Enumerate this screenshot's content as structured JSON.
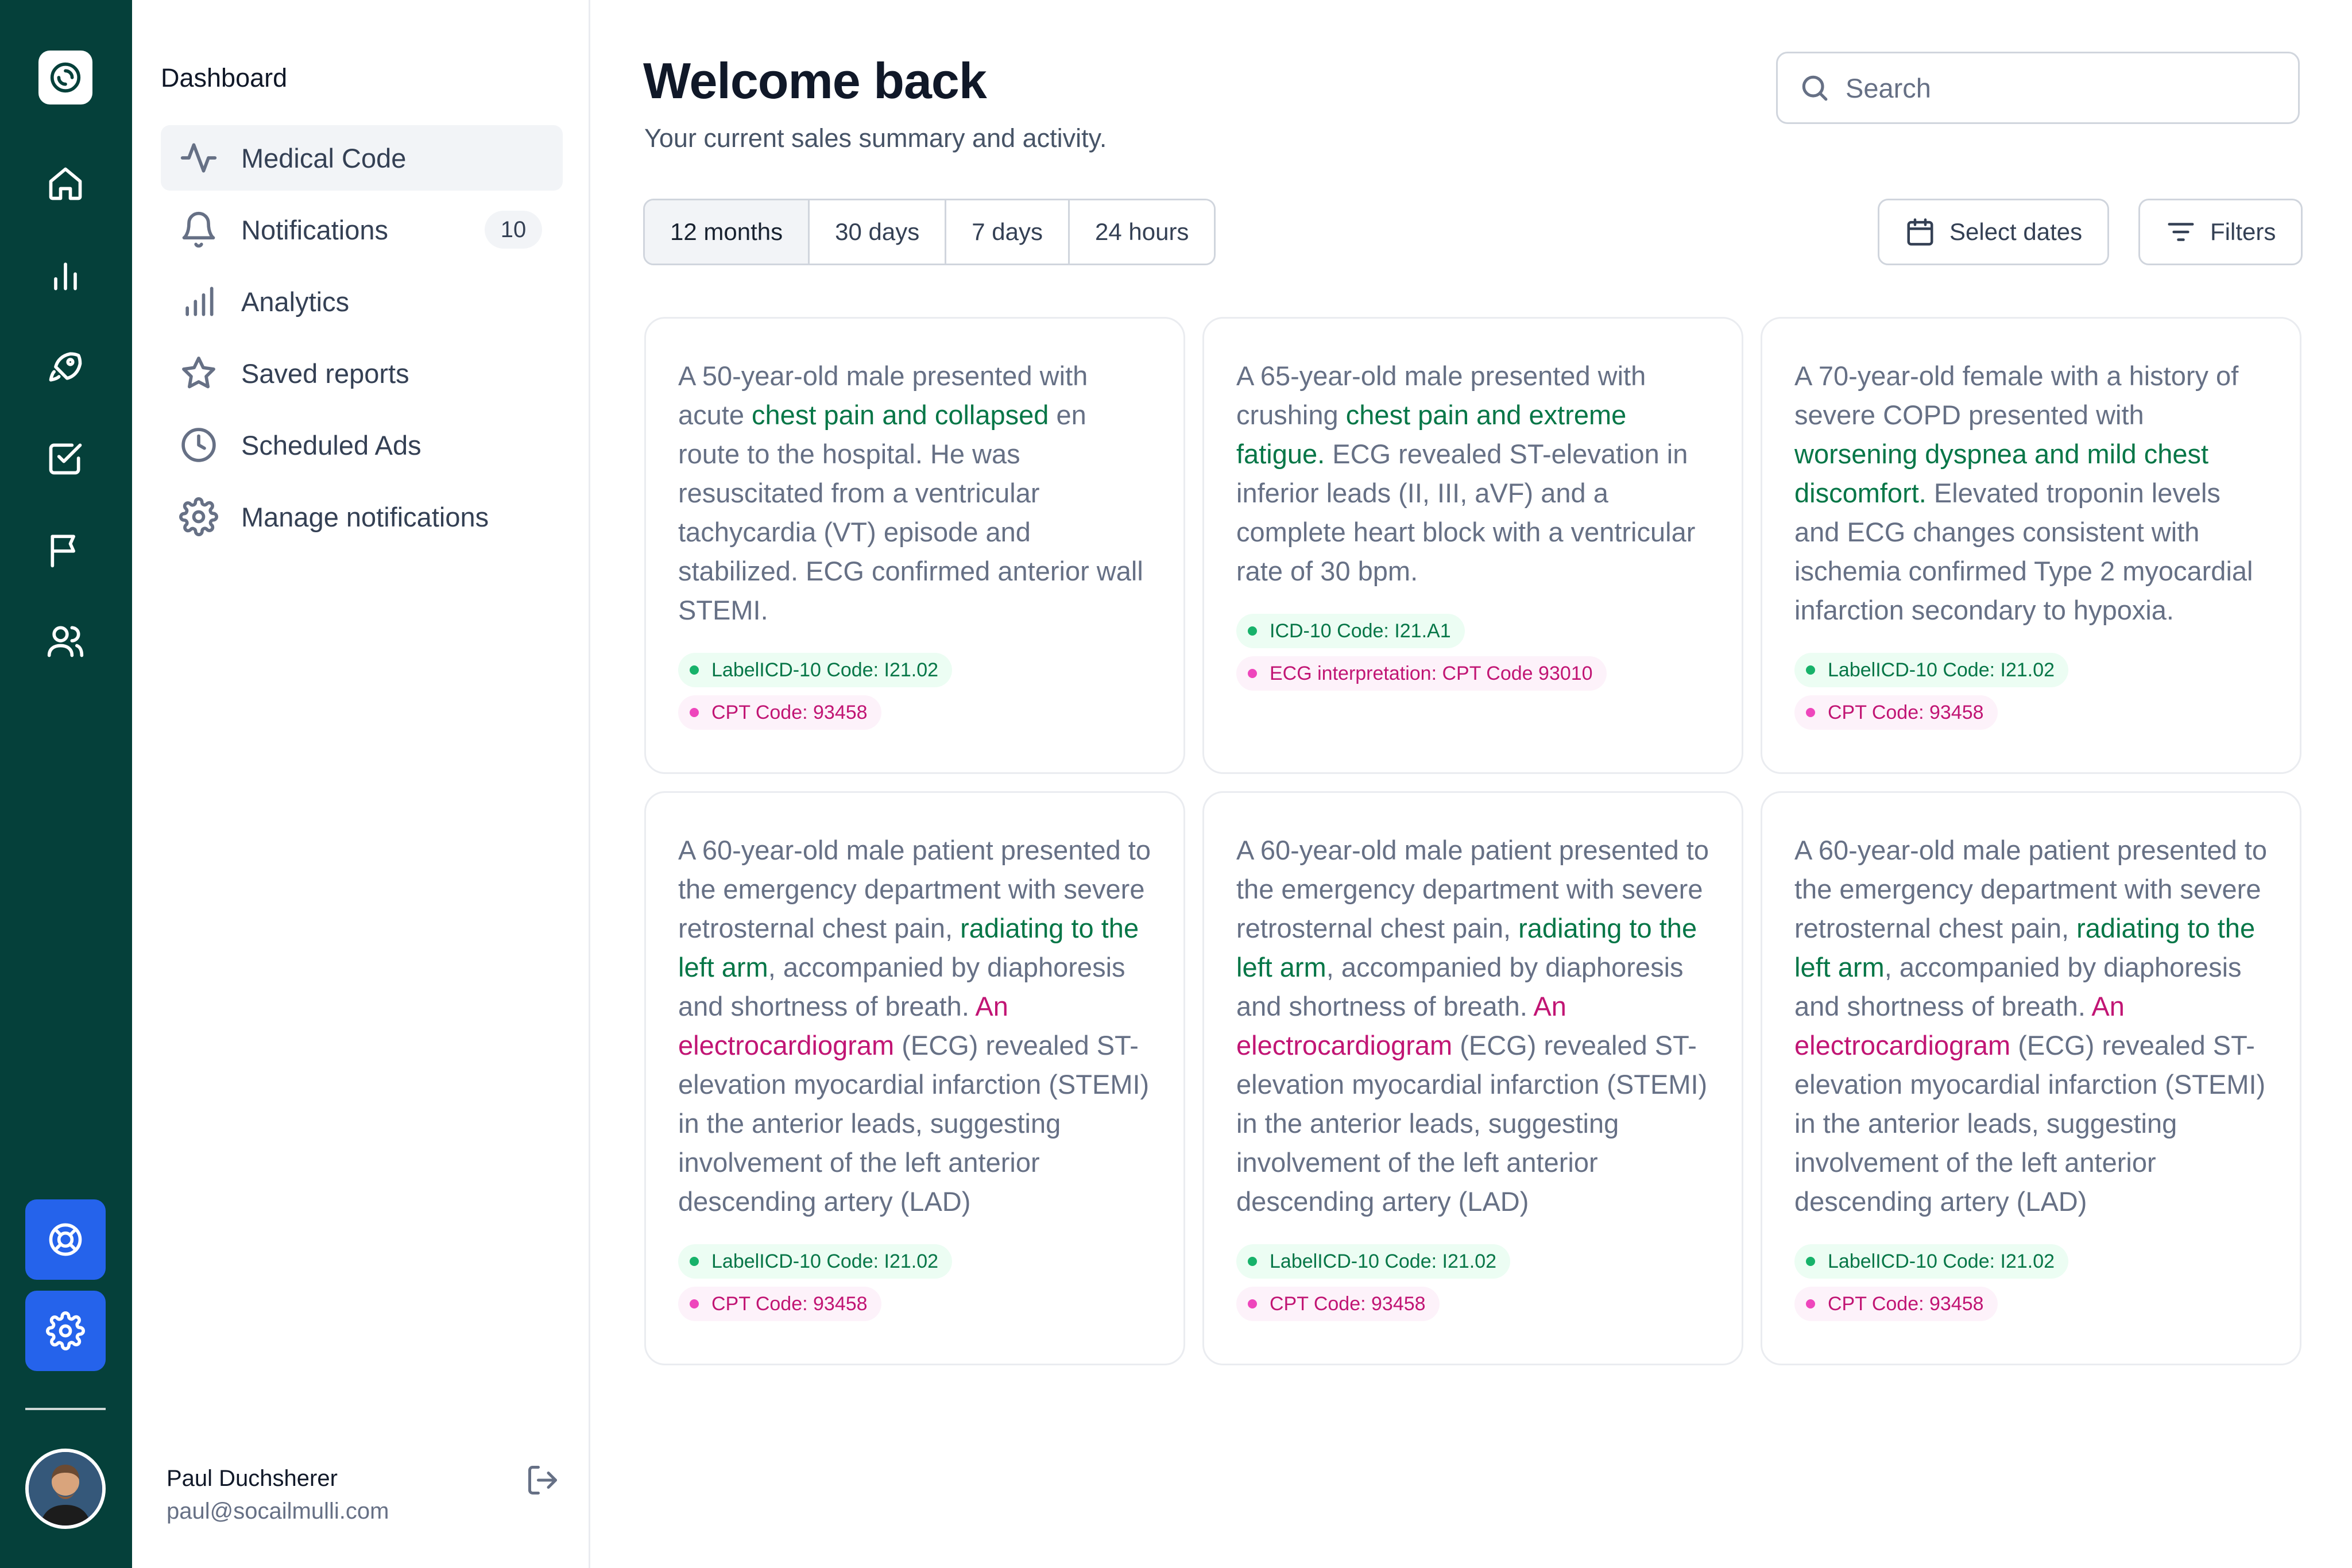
{
  "sidebar": {
    "title": "Dashboard",
    "items": [
      {
        "label": "Medical Code",
        "icon": "activity-icon",
        "active": true
      },
      {
        "label": "Notifications",
        "icon": "bell-icon",
        "badge": "10"
      },
      {
        "label": "Analytics",
        "icon": "bar-chart-icon"
      },
      {
        "label": "Saved reports",
        "icon": "star-icon"
      },
      {
        "label": "Scheduled Ads",
        "icon": "clock-icon"
      },
      {
        "label": "Manage notifications",
        "icon": "gear-icon"
      }
    ],
    "user": {
      "name": "Paul Duchsherer",
      "email": "paul@socailmulli.com"
    }
  },
  "rail": {
    "icons": [
      "logo-icon",
      "home-icon",
      "bar-chart-icon",
      "rocket-icon",
      "check-square-icon",
      "flag-icon",
      "users-icon",
      "life-buoy-icon",
      "settings-icon"
    ]
  },
  "header": {
    "title": "Welcome back",
    "subtitle": "Your current sales summary and activity.",
    "search_placeholder": "Search"
  },
  "ranges": [
    {
      "label": "12 months",
      "active": true
    },
    {
      "label": "30 days"
    },
    {
      "label": "7 days"
    },
    {
      "label": "24 hours"
    }
  ],
  "toolbar": {
    "select_dates": "Select dates",
    "filters": "Filters"
  },
  "cards": [
    {
      "segments": [
        {
          "t": "A 50-year-old male presented with acute ",
          "c": ""
        },
        {
          "t": "chest pain and collapsed",
          "c": "g"
        },
        {
          "t": " en route to the hospital. He was resuscitated from a ventricular tachycardia (VT) episode and stabilized. ECG confirmed anterior wall STEMI.",
          "c": ""
        }
      ],
      "tags": [
        {
          "text": "LabelICD-10 Code: I21.02",
          "color": "green"
        },
        {
          "text": "CPT Code: 93458",
          "color": "pink"
        }
      ]
    },
    {
      "segments": [
        {
          "t": "A 65-year-old male presented with crushing ",
          "c": ""
        },
        {
          "t": "chest pain and extreme fatigue.",
          "c": "g"
        },
        {
          "t": " ECG revealed ST-elevation in inferior leads (II, III, aVF) and a complete heart block with a ventricular rate of 30 bpm.",
          "c": ""
        }
      ],
      "tags": [
        {
          "text": "ICD-10 Code: I21.A1",
          "color": "green"
        },
        {
          "text": "ECG interpretation: CPT Code 93010",
          "color": "pink"
        }
      ]
    },
    {
      "segments": [
        {
          "t": "A 70-year-old female with a history of severe COPD presented with ",
          "c": ""
        },
        {
          "t": "worsening dyspnea and mild chest discomfort.",
          "c": "g"
        },
        {
          "t": " Elevated troponin levels and ECG changes consistent with ischemia confirmed Type 2 myocardial infarction secondary to hypoxia.",
          "c": ""
        }
      ],
      "tags": [
        {
          "text": "LabelICD-10 Code: I21.02",
          "color": "green"
        },
        {
          "text": "CPT Code: 93458",
          "color": "pink"
        }
      ]
    },
    {
      "segments": [
        {
          "t": "A 60-year-old male patient presented to the emergency department with severe retrosternal chest pain, ",
          "c": ""
        },
        {
          "t": "radiating to the left arm",
          "c": "g"
        },
        {
          "t": ", accompanied by diaphoresis and shortness of breath. ",
          "c": ""
        },
        {
          "t": "An electrocardiogram",
          "c": "p"
        },
        {
          "t": " (ECG) revealed ST-elevation myocardial infarction (STEMI) in the anterior leads, suggesting involvement of the left anterior descending artery (LAD)",
          "c": ""
        }
      ],
      "tags": [
        {
          "text": "LabelICD-10 Code: I21.02",
          "color": "green"
        },
        {
          "text": "CPT Code: 93458",
          "color": "pink"
        }
      ]
    },
    {
      "segments": [
        {
          "t": "A 60-year-old male patient presented to the emergency department with severe retrosternal chest pain, ",
          "c": ""
        },
        {
          "t": "radiating to the left arm",
          "c": "g"
        },
        {
          "t": ", accompanied by diaphoresis and shortness of breath. ",
          "c": ""
        },
        {
          "t": "An electrocardiogram",
          "c": "p"
        },
        {
          "t": " (ECG) revealed ST-elevation myocardial infarction (STEMI) in the anterior leads, suggesting involvement of the left anterior descending artery (LAD)",
          "c": ""
        }
      ],
      "tags": [
        {
          "text": "LabelICD-10 Code: I21.02",
          "color": "green"
        },
        {
          "text": "CPT Code: 93458",
          "color": "pink"
        }
      ]
    },
    {
      "segments": [
        {
          "t": "A 60-year-old male patient presented to the emergency department with severe retrosternal chest pain, ",
          "c": ""
        },
        {
          "t": "radiating to the left arm",
          "c": "g"
        },
        {
          "t": ", accompanied by diaphoresis and shortness of breath. ",
          "c": ""
        },
        {
          "t": "An electrocardiogram",
          "c": "p"
        },
        {
          "t": " (ECG) revealed ST-elevation myocardial infarction (STEMI) in the anterior leads, suggesting involvement of the left anterior descending artery (LAD)",
          "c": ""
        }
      ],
      "tags": [
        {
          "text": "LabelICD-10 Code: I21.02",
          "color": "green"
        },
        {
          "text": "CPT Code: 93458",
          "color": "pink"
        }
      ]
    }
  ],
  "colors": {
    "rail": "#05403a",
    "accent_blue": "#2563eb",
    "highlight_green": "#067647",
    "highlight_pink": "#c11574"
  }
}
